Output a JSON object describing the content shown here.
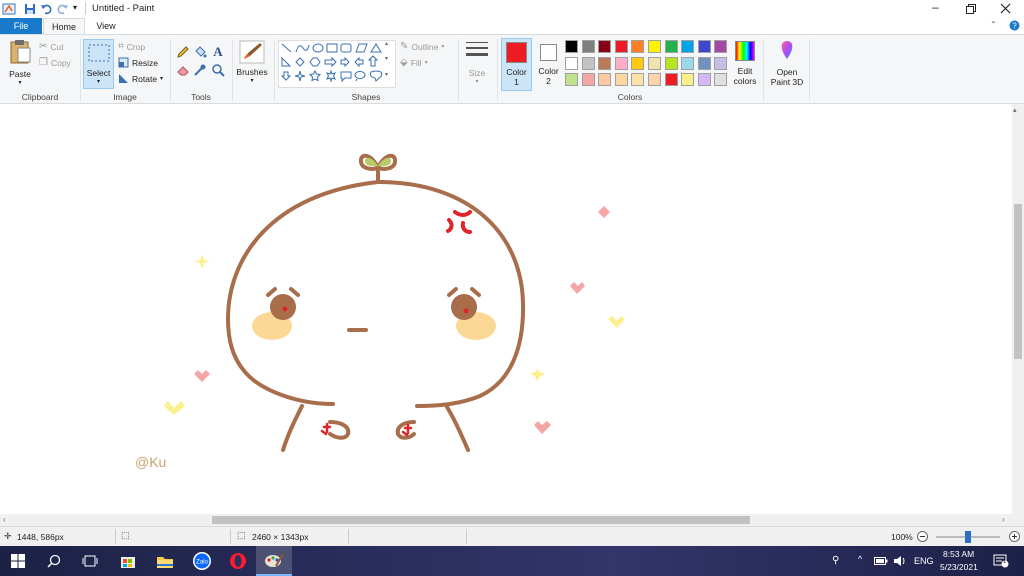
{
  "window": {
    "title": "Untitled - Paint",
    "quick_access": [
      "save-icon",
      "undo-icon",
      "redo-icon",
      "customize-icon"
    ],
    "controls": [
      "minimize-icon",
      "restore-icon",
      "close-icon"
    ]
  },
  "tabs": [
    {
      "label": "File",
      "active": false,
      "accent": "#1979ca"
    },
    {
      "label": "Home",
      "active": true
    },
    {
      "label": "View",
      "active": false
    }
  ],
  "ribbon": {
    "clipboard": {
      "paste": "Paste",
      "cut": "Cut",
      "copy": "Copy",
      "label": "Clipboard"
    },
    "image": {
      "select": "Select",
      "crop": "Crop",
      "resize": "Resize",
      "rotate": "Rotate",
      "label": "Image"
    },
    "tools": {
      "label": "Tools"
    },
    "brushes": {
      "label": "Brushes"
    },
    "shapes": {
      "outline": "Outline",
      "fill": "Fill",
      "label": "Shapes"
    },
    "size": {
      "label": "Size"
    },
    "colors": {
      "color1_label": "Color",
      "color1_num": "1",
      "color2_label": "Color",
      "color2_num": "2",
      "color1_value": "#ed1c24",
      "color2_value": "#ffffff",
      "edit_colors_line1": "Edit",
      "edit_colors_line2": "colors",
      "label": "Colors",
      "palette": [
        [
          "#000000",
          "#7f7f7f",
          "#880015",
          "#ed1c24",
          "#ff7f27",
          "#fff200",
          "#22b14c",
          "#00a2e8",
          "#3f48cc",
          "#a349a4"
        ],
        [
          "#ffffff",
          "#c3c3c3",
          "#b97a57",
          "#ffaec9",
          "#ffc90e",
          "#efe4b0",
          "#b5e61d",
          "#99d9ea",
          "#7092be",
          "#c8bfe7"
        ],
        [
          "#bfe08f",
          "#f4a6a6",
          "#fcc9a4",
          "#fcd8a0",
          "#fbe2a8",
          "#fcd3ab",
          "#ed1c24",
          "#f9f08c",
          "#d3b8f5",
          "#e0e0e0"
        ]
      ]
    },
    "paint3d": {
      "line1": "Open",
      "line2": "Paint 3D"
    }
  },
  "drawing": {
    "signature": "@Ku"
  },
  "status": {
    "cursor_pos": "1448, 586px",
    "image_size": "2460 × 1343px",
    "zoom": "100%"
  },
  "taskbar": {
    "apps": [
      "windows-start-icon",
      "search-icon",
      "task-view-icon",
      "store-icon",
      "file-explorer-icon",
      "zalo-icon",
      "opera-icon",
      "paint-icon"
    ],
    "language": "ENG",
    "time": "8:53 AM",
    "date": "5/23/2021",
    "notification_count": "1",
    "zalo_text": "Zalo"
  }
}
